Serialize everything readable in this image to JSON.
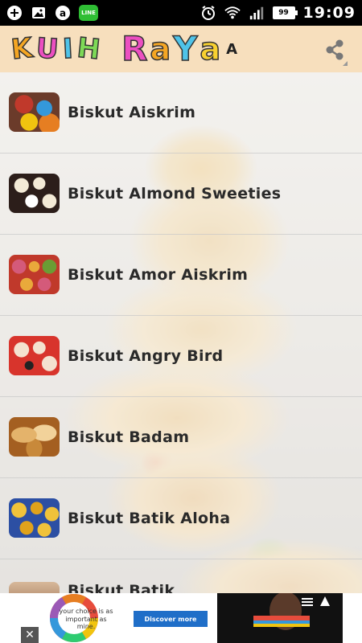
{
  "status_bar": {
    "time": "19:09",
    "battery": "99",
    "line_badge": "LINE",
    "icons_left": [
      "plus-icon",
      "image-icon",
      "a-circle-icon",
      "line-icon"
    ],
    "icons_right": [
      "alarm-icon",
      "wifi-icon",
      "signal-icon",
      "battery-icon"
    ]
  },
  "app_bar": {
    "title_letters": [
      {
        "char": "K",
        "color": "#f5a623"
      },
      {
        "char": "U",
        "color": "#ec4fc1"
      },
      {
        "char": "I",
        "color": "#4fc3e8"
      },
      {
        "char": "H",
        "color": "#7ed957"
      },
      {
        "char": "R",
        "color": "#ec4fc1"
      },
      {
        "char": "a",
        "color": "#f5a623"
      },
      {
        "char": "Y",
        "color": "#4fc3e8"
      },
      {
        "char": "a",
        "color": "#f8d130"
      }
    ],
    "title_suffix": "A",
    "share_icon": "share-icon"
  },
  "list": {
    "items": [
      {
        "label": "Biskut Aiskrim",
        "thumb_colors": [
          "#c0392b",
          "#e67e22",
          "#3498db",
          "#f1c40f"
        ]
      },
      {
        "label": "Biskut Almond Sweeties",
        "thumb_colors": [
          "#2c1e1a",
          "#f3ead6",
          "#3b2a22",
          "#ffffff"
        ]
      },
      {
        "label": "Biskut Amor Aiskrim",
        "thumb_colors": [
          "#c0392b",
          "#e9a93b",
          "#d45a7a",
          "#6a9d34"
        ]
      },
      {
        "label": "Biskut Angry Bird",
        "thumb_colors": [
          "#d8342c",
          "#f4e2d0",
          "#222222",
          "#ffffff"
        ]
      },
      {
        "label": "Biskut Badam",
        "thumb_colors": [
          "#c8893a",
          "#e4b36b",
          "#a45f21",
          "#f2d29a"
        ]
      },
      {
        "label": "Biskut Batik Aloha",
        "thumb_colors": [
          "#e0a21b",
          "#2c4fa3",
          "#f0c23a",
          "#213a7a"
        ]
      },
      {
        "label": "Biskut Batik",
        "thumb_colors": [
          "#8b5a3c",
          "#d7b89a",
          "#5c3b26",
          "#efe0cc"
        ]
      }
    ]
  },
  "ad": {
    "text": "your choice is as important as mine.",
    "button": "Discover more",
    "close": "✕"
  }
}
